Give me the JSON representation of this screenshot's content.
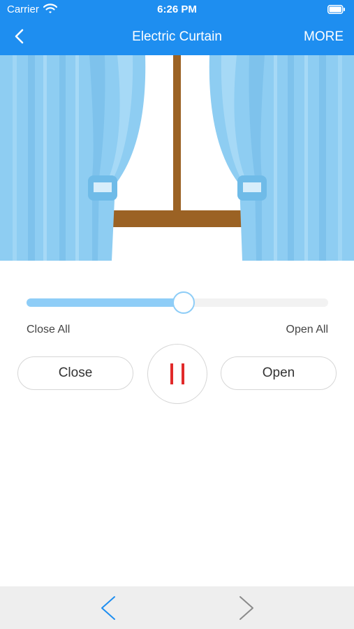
{
  "status_bar": {
    "carrier": "Carrier",
    "time": "6:26 PM",
    "wifi_icon": "wifi-icon",
    "battery_icon": "battery-icon"
  },
  "nav": {
    "back_icon": "chevron-left-icon",
    "title": "Electric Curtain",
    "more_label": "MORE"
  },
  "curtain": {
    "position_percent": 52,
    "colors": {
      "curtain": "#8ecdf2",
      "curtain_dark": "#6fbbe8",
      "frame": "#9b6224",
      "header": "#1e8ef0"
    }
  },
  "slider": {
    "min_label": "Close All",
    "max_label": "Open All",
    "value_percent": 52
  },
  "controls": {
    "close_label": "Close",
    "pause_icon": "pause-icon",
    "open_label": "Open"
  },
  "bottom_bar": {
    "prev_icon": "chevron-left-icon",
    "next_icon": "chevron-right-icon",
    "prev_color": "#1e8ef0",
    "next_color": "#8a8a8a"
  }
}
